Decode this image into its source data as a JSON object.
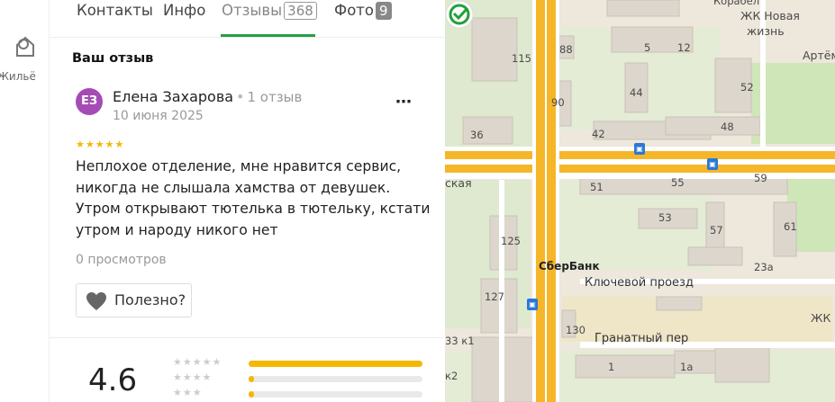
{
  "rail": {
    "item_label": "Жильё",
    "item_icon": "housing-icon"
  },
  "tabs": [
    {
      "label": "Контакты"
    },
    {
      "label": "Инфо"
    },
    {
      "label": "Отзывы",
      "count": "368",
      "active": true
    },
    {
      "label": "Фото",
      "count": "9"
    }
  ],
  "section_title": "Ваш отзыв",
  "review": {
    "avatar_initials": "ЕЗ",
    "avatar_color": "#a54bb5",
    "author": "Елена Захарова",
    "author_reviews": "1 отзыв",
    "date": "10 июня 2025",
    "stars": "★★★★★",
    "text": "Неплохое отделение, мне нравится сервис, никогда не слышала хамства от девушек. Утром открывают тютелька в тютельку, кстати утром и народу никого нет",
    "views": "0 просмотров",
    "helpful_label": "Полезно?"
  },
  "summary": {
    "rating": "4.6",
    "distribution": [
      {
        "stars": "★★★★★",
        "fraction": 1.0
      },
      {
        "stars": "★★★★",
        "fraction": 0.03
      },
      {
        "stars": "★★★",
        "fraction": 0.03
      }
    ]
  },
  "map": {
    "poi_label": "СберБанк",
    "street_labels": [
      "Ключевой проезд",
      "Гранатный пер",
      "ская",
      "ЖК Новая",
      "жизнь",
      "Артём",
      "ЖК Н",
      "Корабел"
    ],
    "building_numbers": [
      "88",
      "5",
      "12",
      "115",
      "90",
      "44",
      "52",
      "36",
      "42",
      "48",
      "51",
      "55",
      "59",
      "53",
      "125",
      "57",
      "61",
      "23а",
      "127",
      "130",
      "33 к1",
      "1",
      "1а",
      "к2"
    ]
  },
  "colors": {
    "accent": "#23a045",
    "star": "#f5b700",
    "road": "#f6b62a"
  }
}
